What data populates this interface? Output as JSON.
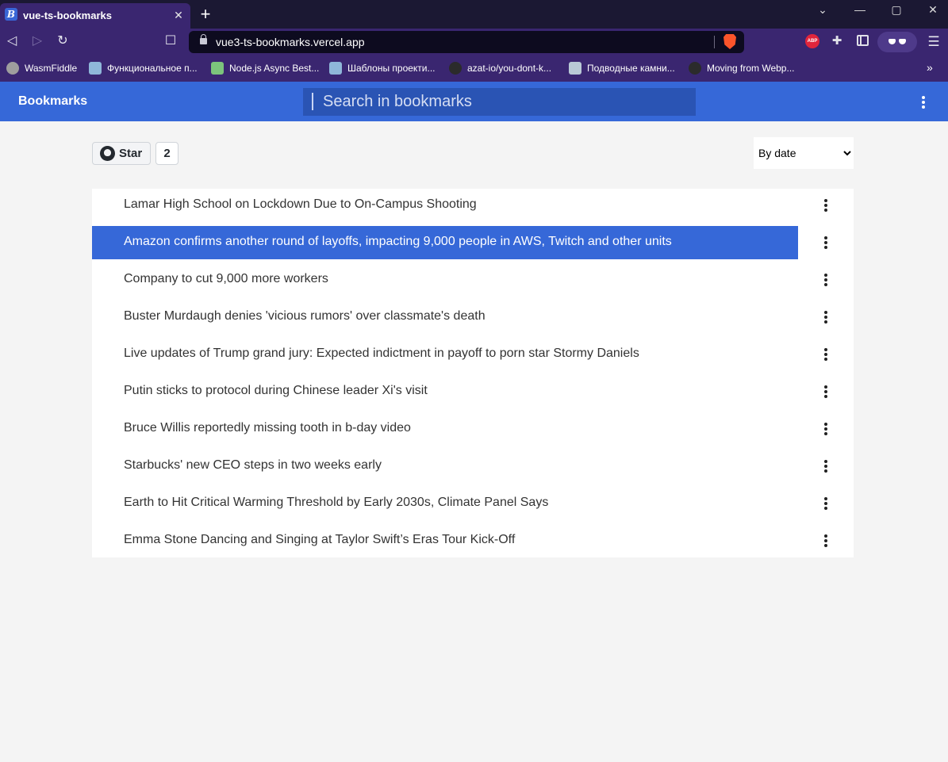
{
  "browser": {
    "tab": {
      "title": "vue-ts-bookmarks",
      "favicon_letter": "B"
    },
    "url": "vue3-ts-bookmarks.vercel.app",
    "bookmarks": [
      {
        "label": "WasmFiddle",
        "icon_color": "#9e9e9e"
      },
      {
        "label": "Функциональное п...",
        "icon_color": "#8fb7d9"
      },
      {
        "label": "Node.js Async Best...",
        "icon_color": "#7cc47c"
      },
      {
        "label": "Шаблоны проекти...",
        "icon_color": "#8fb7d9"
      },
      {
        "label": "azat-io/you-dont-k...",
        "icon_color": "#2b2b2b"
      },
      {
        "label": "Подводные камни...",
        "icon_color": "#b9c9d6"
      },
      {
        "label": "Moving from Webp...",
        "icon_color": "#2b2b2b"
      }
    ],
    "extensions": {
      "abp_label": "ABP"
    }
  },
  "app": {
    "title": "Bookmarks",
    "search_placeholder": "Search in bookmarks",
    "github": {
      "star_label": "Star",
      "star_count": "2"
    },
    "sort": {
      "selected": "By date"
    },
    "accent_color": "#3668d8",
    "bookmarks": [
      {
        "title": "Lamar High School on Lockdown Due to On-Campus Shooting",
        "active": false
      },
      {
        "title": "Amazon confirms another round of layoffs, impacting 9,000 people in AWS, Twitch and other units",
        "active": true
      },
      {
        "title": "Company to cut 9,000 more workers",
        "active": false
      },
      {
        "title": "Buster Murdaugh denies 'vicious rumors' over classmate's death",
        "active": false
      },
      {
        "title": "Live updates of Trump grand jury: Expected indictment in payoff to porn star Stormy Daniels",
        "active": false
      },
      {
        "title": "Putin sticks to protocol during Chinese leader Xi's visit",
        "active": false
      },
      {
        "title": "Bruce Willis reportedly missing tooth in b-day video",
        "active": false
      },
      {
        "title": "Starbucks' new CEO steps in two weeks early",
        "active": false
      },
      {
        "title": "Earth to Hit Critical Warming Threshold by Early 2030s, Climate Panel Says",
        "active": false
      },
      {
        "title": "Emma Stone Dancing and Singing at Taylor Swift’s Eras Tour Kick-Off",
        "active": false
      }
    ]
  }
}
